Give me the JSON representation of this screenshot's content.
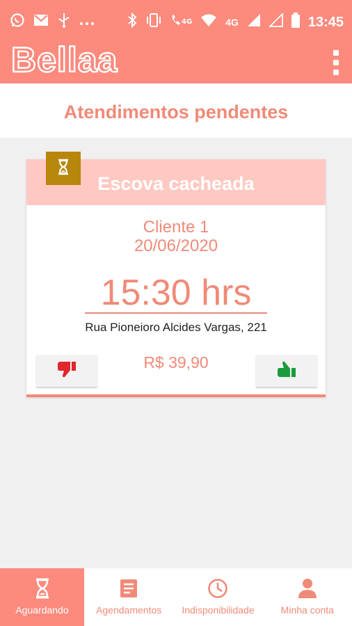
{
  "status_bar": {
    "time": "13:45",
    "network_label": "4G",
    "call_network_label": "4G",
    "icons": [
      "whatsapp-icon",
      "gmail-icon",
      "usb-icon",
      "more-icon",
      "bluetooth-icon",
      "vibrate-icon",
      "volte-icon",
      "wifi-icon",
      "signal-icon",
      "signal-empty-icon",
      "battery-icon"
    ]
  },
  "app": {
    "logo": "Bellaa",
    "page_title": "Atendimentos pendentes"
  },
  "colors": {
    "primary": "#fc8a7d",
    "accent_text": "#f08a78",
    "card_header": "#ffc9c2",
    "badge": "#b8860b",
    "reject": "#e1262d",
    "accept": "#1c9a3e"
  },
  "appointment": {
    "service": "Escova cacheada",
    "client": "Cliente 1",
    "date": "20/06/2020",
    "time": "15:30 hrs",
    "address": "Rua Pioneioro Alcides Vargas, 221",
    "price": "R$ 39,90",
    "status_icon": "hourglass-icon",
    "reject_icon": "thumbs-down-icon",
    "accept_icon": "thumbs-up-icon"
  },
  "bottom_nav": {
    "active_index": 0,
    "items": [
      {
        "label": "Aguardando",
        "icon": "hourglass-icon"
      },
      {
        "label": "Agendamentos",
        "icon": "list-icon"
      },
      {
        "label": "Indisponibilidade",
        "icon": "clock-icon"
      },
      {
        "label": "Minha conta",
        "icon": "person-icon"
      }
    ]
  }
}
